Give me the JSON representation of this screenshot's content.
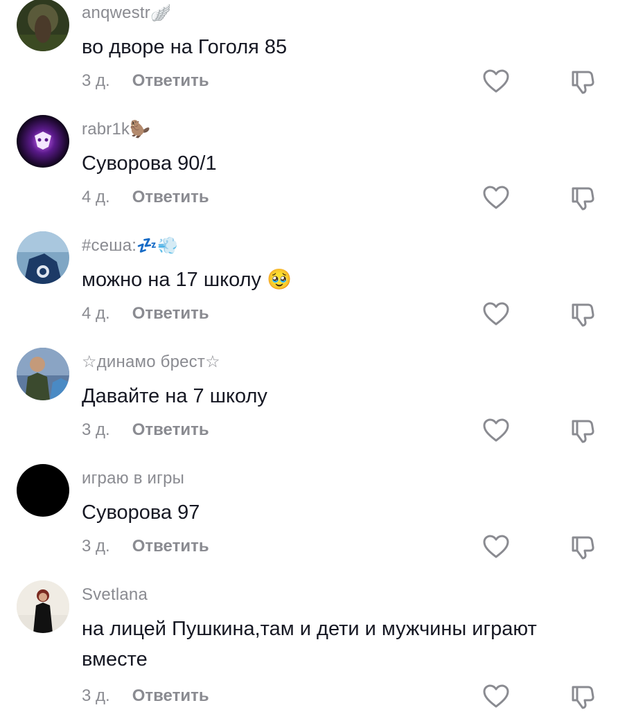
{
  "comments": [
    {
      "username": "anqwestr",
      "username_deco": "🪽",
      "text": "во дворе на Гоголя 85",
      "time": "3 д.",
      "reply_label": "Ответить"
    },
    {
      "username": "rabr1k",
      "username_deco": "🦫",
      "text": "Суворова 90/1",
      "time": "4 д.",
      "reply_label": "Ответить"
    },
    {
      "username": "#сеша:",
      "username_deco": "💤💨",
      "text": "можно на 17 школу",
      "text_emoji": "🥹",
      "time": "4 д.",
      "reply_label": "Ответить"
    },
    {
      "username": "☆динамо брест☆",
      "text": "Давайте на 7 школу",
      "time": "3 д.",
      "reply_label": "Ответить"
    },
    {
      "username": "играю в игры",
      "text": "Суворова 97",
      "time": "3 д.",
      "reply_label": "Ответить"
    },
    {
      "username": "Svetlana",
      "text": "на лицей Пушкина,там и дети и мужчины играют вместе",
      "time": "3 д.",
      "reply_label": "Ответить"
    }
  ]
}
